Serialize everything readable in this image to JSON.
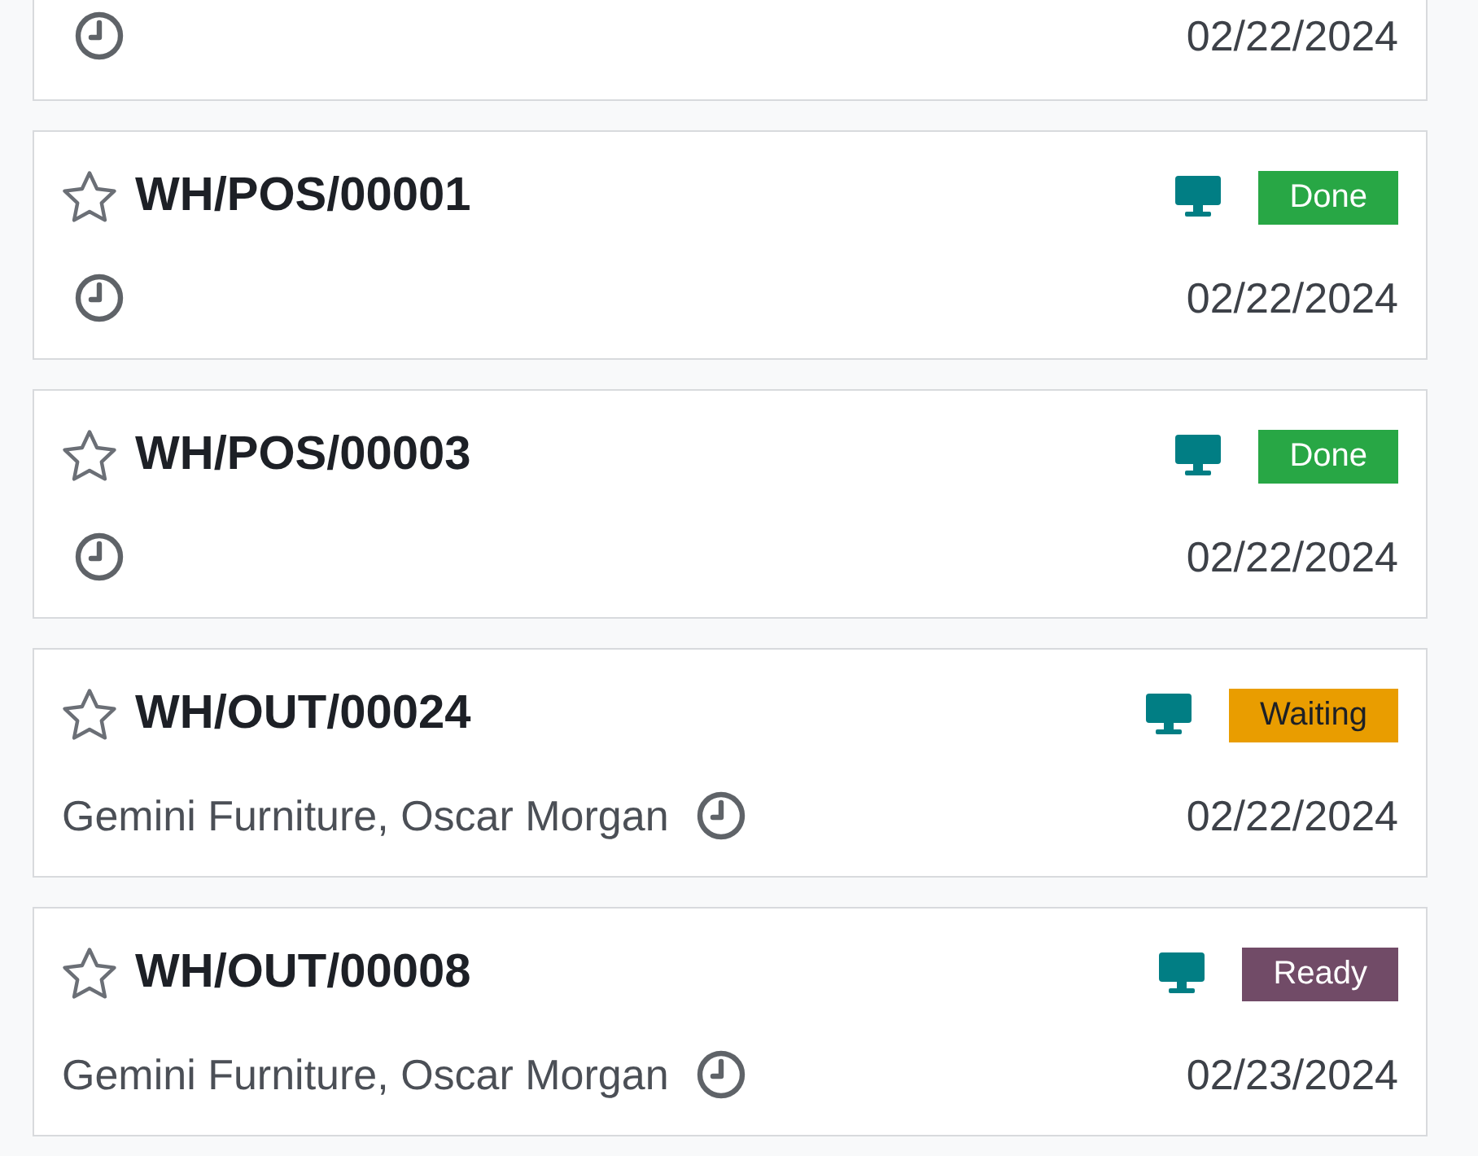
{
  "cards": [
    {
      "date": "02/22/2024"
    },
    {
      "title": "WH/POS/00001",
      "starred": false,
      "status": {
        "label": "Done",
        "color": "#28a745"
      },
      "date": "02/22/2024"
    },
    {
      "title": "WH/POS/00003",
      "starred": false,
      "status": {
        "label": "Done",
        "color": "#28a745"
      },
      "date": "02/22/2024"
    },
    {
      "title": "WH/OUT/00024",
      "starred": false,
      "status": {
        "label": "Waiting",
        "color": "#e99d00"
      },
      "partner": "Gemini Furniture, Oscar Morgan",
      "date": "02/22/2024"
    },
    {
      "title": "WH/OUT/00008",
      "starred": false,
      "status": {
        "label": "Ready",
        "color": "#714b67"
      },
      "partner": "Gemini Furniture, Oscar Morgan",
      "date": "02/23/2024"
    }
  ]
}
